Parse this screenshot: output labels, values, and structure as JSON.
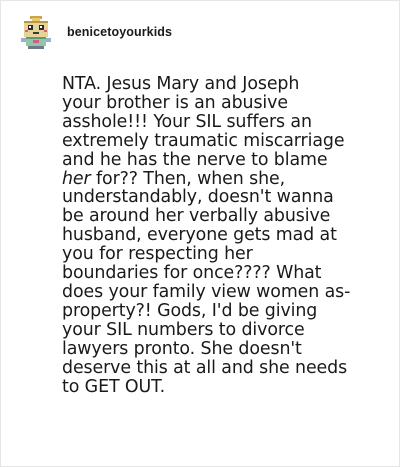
{
  "post": {
    "author": {
      "username": "benicetoyourkids",
      "avatar_icon": "pixel-robot-avatar-icon"
    },
    "body_lines": [
      "NTA. Jesus Mary and Joseph",
      "your brother is an abusive",
      "asshole!!! Your SIL suffers an",
      "extremely traumatic miscarriage",
      "and he has the nerve to blame",
      {
        "emphasis": "her",
        "rest": " for?? Then, when she,"
      },
      "understandably, doesn't wanna",
      "be around her verbally abusive",
      "husband, everyone gets mad at",
      "you for respecting her",
      "boundaries for once???? What",
      "does your family view women as-",
      "property?! Gods, I'd be giving",
      "your SIL numbers to divorce",
      "lawyers pronto. She doesn't",
      "deserve this at all and she needs",
      "to GET OUT."
    ]
  },
  "colors": {
    "text": "#1a1a1a",
    "border": "#e6e6e6",
    "background": "#ffffff"
  }
}
